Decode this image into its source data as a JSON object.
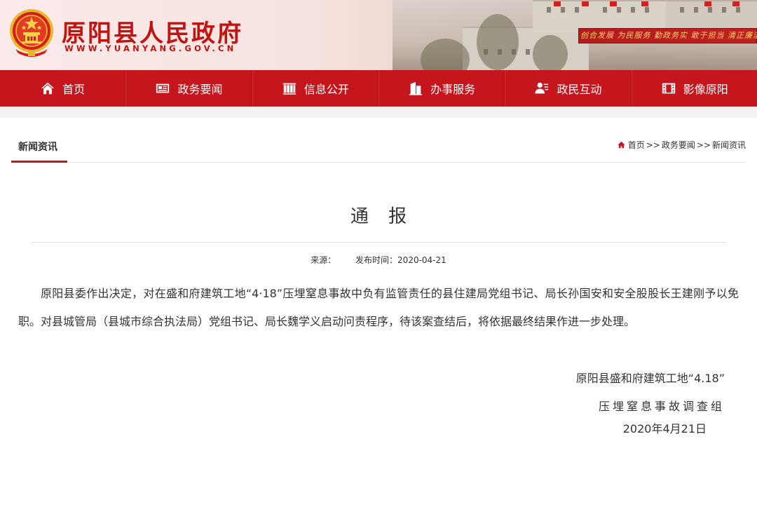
{
  "header": {
    "site_title": "原阳县人民政府",
    "site_url": "WWW.YUANYANG.GOV.CN",
    "slogan": "创合发展 为民服务 勤政务实 敢于担当 清正廉洁"
  },
  "nav": {
    "items": [
      {
        "label": "首页",
        "icon": "home-icon"
      },
      {
        "label": "政务要闻",
        "icon": "newspaper-icon"
      },
      {
        "label": "信息公开",
        "icon": "book-icon"
      },
      {
        "label": "办事服务",
        "icon": "building-icon"
      },
      {
        "label": "政民互动",
        "icon": "people-icon"
      },
      {
        "label": "影像原阳",
        "icon": "film-icon"
      }
    ]
  },
  "section": {
    "tab": "新闻资讯",
    "breadcrumb": [
      "首页",
      "政务要闻",
      "新闻资讯"
    ],
    "separator": ">>"
  },
  "article": {
    "title": "通 报",
    "source_label": "来源：",
    "source_value": "",
    "date_label": "发布时间：",
    "date_value": "2020-04-21",
    "body": "原阳县委作出决定，对在盛和府建筑工地“4·18”压埋窒息事故中负有监管责任的县住建局党组书记、局长孙国安和安全股股长王建刚予以免职。对县城管局（县城市综合执法局）党组书记、局长魏学义启动问责程序，待该案查结后，将依据最终结果作进一步处理。",
    "sign_line1": "原阳县盛和府建筑工地“4.18”",
    "sign_line2": "压埋窒息事故调查组",
    "sign_date": "2020年4月21日"
  },
  "colors": {
    "brand_red": "#c4161c",
    "title_red": "#c1130f"
  }
}
